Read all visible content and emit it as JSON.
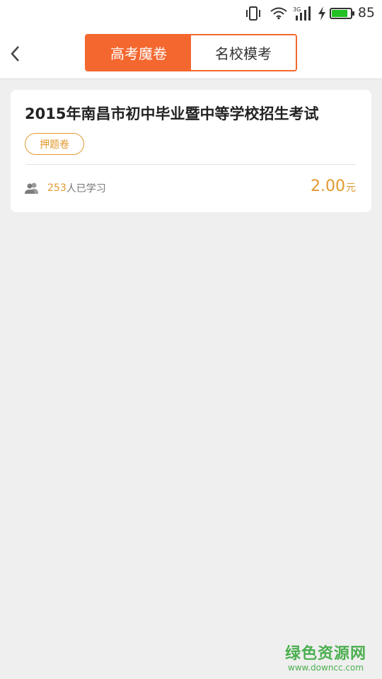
{
  "status_bar": {
    "icons": [
      "vibrate-icon",
      "wifi-icon",
      "signal-3g-icon",
      "charging-icon",
      "battery-icon"
    ],
    "network_label": "3G",
    "battery_level": "85",
    "battery_fraction": 0.85,
    "battery_color": "#22c022"
  },
  "header": {
    "back_icon": "chevron-left-icon",
    "tabs": [
      {
        "label": "高考魔卷",
        "active": true
      },
      {
        "label": "名校模考",
        "active": false
      }
    ],
    "accent_color": "#f4672f"
  },
  "papers": [
    {
      "title": "2015年南昌市初中毕业暨中等学校招生考试",
      "tag": "押题卷",
      "learner_count": "253",
      "learner_suffix": "人已学习",
      "price": "2.00",
      "price_unit": "元",
      "highlight_color": "#e2992e"
    }
  ],
  "watermark": {
    "title": "绿色资源网",
    "url": "www.downcc.com"
  }
}
